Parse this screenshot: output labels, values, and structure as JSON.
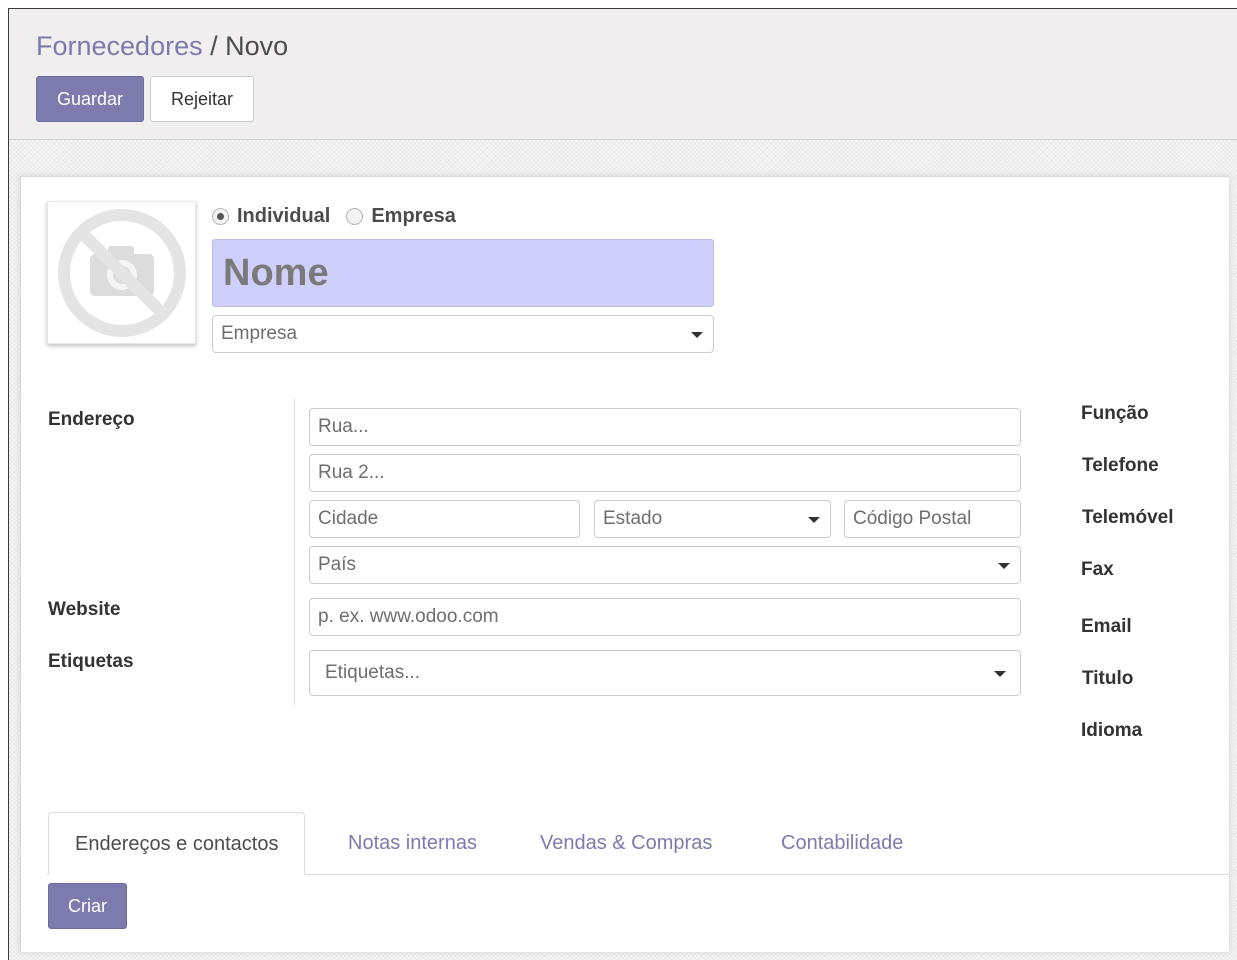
{
  "breadcrumb": {
    "parent": "Fornecedores",
    "separator": "/",
    "current": "Novo"
  },
  "buttons": {
    "save": "Guardar",
    "discard": "Rejeitar",
    "create": "Criar"
  },
  "company_type": {
    "options": [
      "Individual",
      "Empresa"
    ],
    "selected": "Individual"
  },
  "form": {
    "name_placeholder": "Nome",
    "company_placeholder": "Empresa",
    "address_label": "Endereço",
    "street_placeholder": "Rua...",
    "street2_placeholder": "Rua 2...",
    "city_placeholder": "Cidade",
    "state_placeholder": "Estado",
    "zip_placeholder": "Código Postal",
    "country_placeholder": "País",
    "website_label": "Website",
    "website_placeholder": "p. ex. www.odoo.com",
    "tags_label": "Etiquetas",
    "tags_placeholder": "Etiquetas..."
  },
  "right_labels": [
    "Função",
    "Telefone",
    "Telemóvel",
    "Fax",
    "Email",
    "Titulo",
    "Idioma"
  ],
  "tabs": [
    {
      "label": "Endereços e contactos",
      "active": true
    },
    {
      "label": "Notas internas",
      "active": false
    },
    {
      "label": "Vendas & Compras",
      "active": false
    },
    {
      "label": "Contabilidade",
      "active": false
    }
  ],
  "colors": {
    "primary": "#7c7bad",
    "name_field_bg": "#cfcffb"
  },
  "icons": {
    "avatar": "no-camera-icon",
    "dropdown": "caret-down-icon"
  }
}
